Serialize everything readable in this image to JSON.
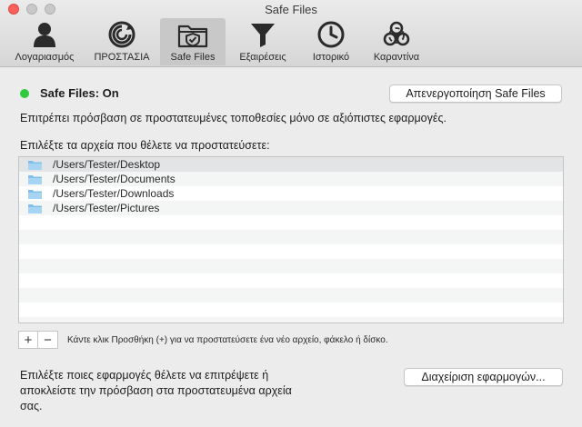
{
  "window": {
    "title": "Safe Files"
  },
  "toolbar": {
    "tabs": [
      {
        "label": "Λογαριασμός",
        "icon": "account-icon"
      },
      {
        "label": "ΠΡΟΣΤΑΣΙΑ",
        "icon": "protection-icon"
      },
      {
        "label": "Safe Files",
        "icon": "safe-files-icon",
        "active": true
      },
      {
        "label": "Εξαιρέσεις",
        "icon": "exclusions-filter-icon"
      },
      {
        "label": "Ιστορικό",
        "icon": "history-clock-icon"
      },
      {
        "label": "Καραντίνα",
        "icon": "quarantine-biohazard-icon"
      }
    ]
  },
  "status": {
    "text": "Safe Files: On",
    "color": "#2fc93d"
  },
  "disable_button": "Απενεργοποίηση Safe Files",
  "description": "Επιτρέπει πρόσβαση σε προστατευμένες τοποθεσίες μόνο σε αξιόπιστες εφαρμογές.",
  "choose_label": "Επιλέξτε τα αρχεία που θέλετε να προστατεύσετε:",
  "folders": [
    "/Users/Tester/Desktop",
    "/Users/Tester/Documents",
    "/Users/Tester/Downloads",
    "/Users/Tester/Pictures"
  ],
  "add_label": "+",
  "remove_label": "−",
  "hint": "Κάντε κλικ Προσθήκη (+) για να προστατεύσετε ένα νέο αρχείο, φάκελο ή δίσκο.",
  "apps_text": "Επιλέξτε ποιες εφαρμογές θέλετε να επιτρέψετε ή αποκλείστε την πρόσβαση στα προστατευμένα αρχεία σας.",
  "manage_button": "Διαχείριση εφαρμογών..."
}
